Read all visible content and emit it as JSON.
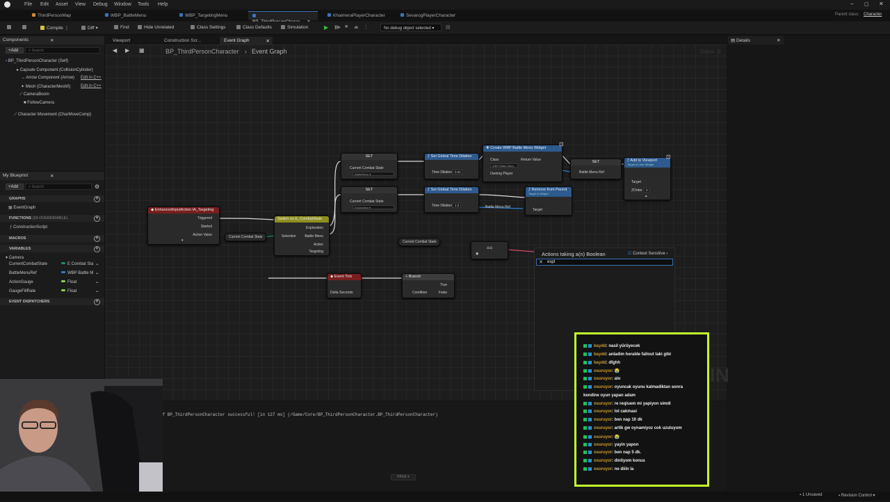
{
  "menu": [
    "File",
    "Edit",
    "Asset",
    "View",
    "Debug",
    "Window",
    "Tools",
    "Help"
  ],
  "doc_tabs": [
    "ThirdPersonMap",
    "WBP_BattleMenu",
    "WBP_TargetingMenu",
    "BP_ThirdPersonCharac...",
    "KhaimeraPlayerCharacter",
    "SevarogPlayerCharacter"
  ],
  "parent_class": {
    "label": "Parent class:",
    "value": "Character"
  },
  "toolbar": {
    "compile": "Compile",
    "diff": "Diff",
    "find": "Find",
    "hide_unrelated": "Hide Unrelated",
    "class_settings": "Class Settings",
    "class_defaults": "Class Defaults",
    "simulation": "Simulation",
    "debug_object": "No debug object selected"
  },
  "components": {
    "title": "Components",
    "add": "+Add",
    "search_placeholder": "Search",
    "items": [
      "BP_ThirdPersonCharacter (Self)",
      "Capsule Component (CollisionCylinder)",
      "Arrow Component (Arrow)",
      "Mesh (CharacterMesh0)",
      "CameraBoom",
      "FollowCamera",
      "Character Movement (CharMoveComp)"
    ],
    "edit_cpp": "Edit in C++"
  },
  "my_blueprint": {
    "title": "My Blueprint",
    "add": "+Add",
    "search_placeholder": "Search",
    "graphs_label": "GRAPHS",
    "event_graph": "EventGraph",
    "functions_label": "FUNCTIONS",
    "functions_count": "(33 OVERRIDABLE)",
    "construction_script": "ConstructionScript",
    "macros_label": "MACROS",
    "variables_label": "VARIABLES",
    "camera": "Camera",
    "variables": [
      {
        "name": "CurrentCombatState",
        "type": "E Combat Sta",
        "color": "#1f8a6d"
      },
      {
        "name": "BattleMenuRef",
        "type": "WBP Battle M",
        "color": "#2b80d0"
      },
      {
        "name": "ActionGauge",
        "type": "Float",
        "color": "#86d34a"
      },
      {
        "name": "GaugeFillRate",
        "type": "Float",
        "color": "#86d34a"
      }
    ],
    "event_dispatchers": "EVENT DISPATCHERS"
  },
  "graph_tabs": [
    "Viewport",
    "Construction Scr...",
    "Event Graph"
  ],
  "breadcrumb": {
    "blueprint": "BP_ThirdPersonCharacter",
    "graph": "Event Graph",
    "zoom": "Zoom -2"
  },
  "nodes": {
    "enhanced_input": {
      "title": "EnhancedInputAction IA_Targeting",
      "pins": [
        "Triggered",
        "Started",
        "Action Value"
      ]
    },
    "switch_enum": {
      "title": "Switch on E_CombatState",
      "in": "Selection",
      "outs": [
        "Exploration",
        "Battle Menu",
        "Action",
        "Targeting"
      ]
    },
    "get_state": "Current Combat State",
    "set1": {
      "title": "SET",
      "pin": "Current Combat State",
      "value": "BattleMenu"
    },
    "set2": {
      "title": "SET",
      "pin": "Current Combat State",
      "value": "Exploration"
    },
    "time_dil1": {
      "title": "Set Global Time Dilation",
      "pin": "Time Dilation",
      "value": "0.01"
    },
    "time_dil2": {
      "title": "Set Global Time Dilation",
      "pin": "Time Dilation",
      "value": "1.0"
    },
    "create_widget": {
      "title": "Create WBP Battle Menu Widget",
      "pins": [
        "Class",
        "Return Value",
        "Owning Player"
      ],
      "class_value": "WBP Battle Menu"
    },
    "set3": {
      "title": "SET",
      "pin": "Battle Menu Ref"
    },
    "add_viewport": {
      "title": "Add to Viewport",
      "subtitle": "Target is User Widget",
      "pins": [
        "Target",
        "ZOrder"
      ],
      "zorder": "0"
    },
    "remove_parent": {
      "title": "Remove from Parent",
      "subtitle": "Target is Widget",
      "pins": [
        "Battle Menu Ref",
        "Target"
      ]
    },
    "get_state2": "Current Combat State",
    "equals": "==",
    "event_tick": {
      "title": "Event Tick",
      "pin": "Delta Seconds"
    },
    "branch": {
      "title": "Branch",
      "pins": [
        "Condition",
        "True",
        "False"
      ]
    }
  },
  "context_menu": {
    "title": "Actions taking a(n) Boolean",
    "context_sensitive": "Context Sensitive",
    "search_value": "expl"
  },
  "details": {
    "title": "Details"
  },
  "log": {
    "message": "of BP_ThirdPersonCharacter successful! [in 127 ms] (/Game/Core/BP_ThirdPersonCharacter.BP_ThirdPersonCharacter)",
    "page": "PAGE"
  },
  "watermark": "PRINT",
  "chat": [
    {
      "user": "baydd",
      "msg": ": nasil yürüyecek"
    },
    {
      "user": "baydd",
      "msg": ": anladim heralde fallout taki gibi"
    },
    {
      "user": "baydd",
      "msg": ": dfghh"
    },
    {
      "user": "osuruyor",
      "msg": ": 😭"
    },
    {
      "user": "osuruyor",
      "msg": ": alo"
    },
    {
      "user": "osuruyor",
      "msg": ": oyuncak oyunu kalmadiktan sonra"
    },
    {
      "user": "",
      "msg": "kendine oyun yapan adam"
    },
    {
      "user": "osuruyor",
      "msg": ": re reqiuem mi yapiyon simdi"
    },
    {
      "user": "osuruyor",
      "msg": ": lol cakmasi"
    },
    {
      "user": "osuruyor",
      "msg": ": ben nap 10 dk"
    },
    {
      "user": "osuruyor",
      "msg": ": artik gw oynamiyoz cok uzuluyom"
    },
    {
      "user": "osuruyor",
      "msg": ": 😭"
    },
    {
      "user": "osuruyor",
      "msg": ": yayin yapon"
    },
    {
      "user": "osuruyor",
      "msg": ": ben nap 5 dk."
    },
    {
      "user": "osuruyor",
      "msg": ": dinliyom konus"
    },
    {
      "user": "osuruyor",
      "msg": ": ne diiin la"
    }
  ],
  "status": {
    "unsaved": "1 Unsaved",
    "revision": "Revision Control"
  }
}
